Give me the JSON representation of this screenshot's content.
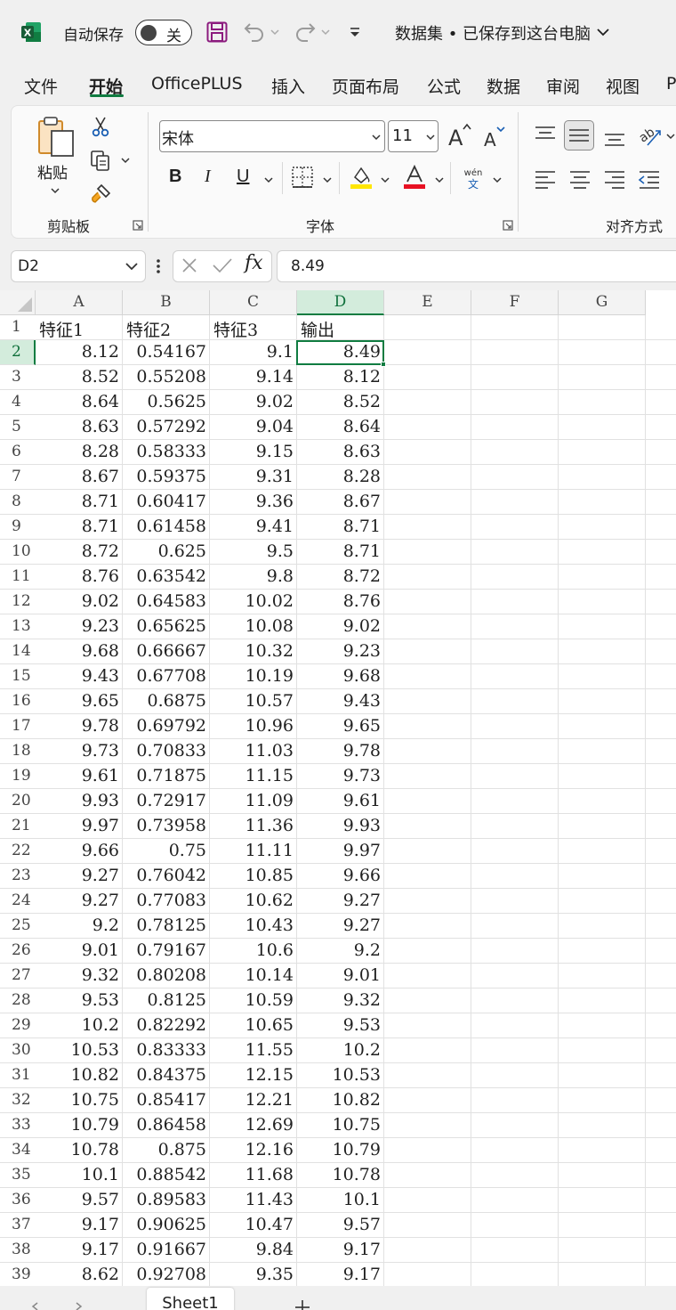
{
  "titlebar": {
    "autosave_label": "自动保存",
    "autosave_state": "关",
    "doc_title": "数据集 • 已保存到这台电脑",
    "logo_icon": "excel-logo-icon"
  },
  "tabs": [
    "文件",
    "开始",
    "OfficePLUS",
    "插入",
    "页面布局",
    "公式",
    "数据",
    "审阅",
    "视图",
    "P"
  ],
  "active_tab": "开始",
  "ribbon": {
    "clipboard_group": "剪贴板",
    "paste_label": "粘贴",
    "font_group": "字体",
    "align_group": "对齐方式",
    "font_name": "宋体",
    "font_size": "11",
    "bold": "B",
    "italic": "I",
    "underline": "U",
    "phonetic_top": "wén",
    "phonetic_bottom": "文",
    "grow_letter": "A",
    "shrink_letter": "A",
    "fill_color": "#ffe600",
    "font_color": "#e81123"
  },
  "formula_bar": {
    "name_box": "D2",
    "fx": "fx",
    "value": "8.49"
  },
  "grid": {
    "columns": [
      "A",
      "B",
      "C",
      "D",
      "E",
      "F",
      "G"
    ],
    "selected_column": "D",
    "selected_row": "2",
    "header_row": [
      "特征1",
      "特征2",
      "特征3",
      "输出"
    ],
    "row_numbers": [
      "1",
      "2",
      "3",
      "4",
      "5",
      "6",
      "7",
      "8",
      "9",
      "10",
      "11",
      "12",
      "13",
      "14",
      "15",
      "16",
      "17",
      "18",
      "19",
      "20",
      "21",
      "22",
      "23",
      "24",
      "25",
      "26",
      "27",
      "28",
      "29",
      "30",
      "31",
      "32",
      "33",
      "34",
      "35",
      "36",
      "37",
      "38",
      "39"
    ],
    "rows": [
      [
        "8.12",
        "0.54167",
        "9.1",
        "8.49"
      ],
      [
        "8.52",
        "0.55208",
        "9.14",
        "8.12"
      ],
      [
        "8.64",
        "0.5625",
        "9.02",
        "8.52"
      ],
      [
        "8.63",
        "0.57292",
        "9.04",
        "8.64"
      ],
      [
        "8.28",
        "0.58333",
        "9.15",
        "8.63"
      ],
      [
        "8.67",
        "0.59375",
        "9.31",
        "8.28"
      ],
      [
        "8.71",
        "0.60417",
        "9.36",
        "8.67"
      ],
      [
        "8.71",
        "0.61458",
        "9.41",
        "8.71"
      ],
      [
        "8.72",
        "0.625",
        "9.5",
        "8.71"
      ],
      [
        "8.76",
        "0.63542",
        "9.8",
        "8.72"
      ],
      [
        "9.02",
        "0.64583",
        "10.02",
        "8.76"
      ],
      [
        "9.23",
        "0.65625",
        "10.08",
        "9.02"
      ],
      [
        "9.68",
        "0.66667",
        "10.32",
        "9.23"
      ],
      [
        "9.43",
        "0.67708",
        "10.19",
        "9.68"
      ],
      [
        "9.65",
        "0.6875",
        "10.57",
        "9.43"
      ],
      [
        "9.78",
        "0.69792",
        "10.96",
        "9.65"
      ],
      [
        "9.73",
        "0.70833",
        "11.03",
        "9.78"
      ],
      [
        "9.61",
        "0.71875",
        "11.15",
        "9.73"
      ],
      [
        "9.93",
        "0.72917",
        "11.09",
        "9.61"
      ],
      [
        "9.97",
        "0.73958",
        "11.36",
        "9.93"
      ],
      [
        "9.66",
        "0.75",
        "11.11",
        "9.97"
      ],
      [
        "9.27",
        "0.76042",
        "10.85",
        "9.66"
      ],
      [
        "9.27",
        "0.77083",
        "10.62",
        "9.27"
      ],
      [
        "9.2",
        "0.78125",
        "10.43",
        "9.27"
      ],
      [
        "9.01",
        "0.79167",
        "10.6",
        "9.2"
      ],
      [
        "9.32",
        "0.80208",
        "10.14",
        "9.01"
      ],
      [
        "9.53",
        "0.8125",
        "10.59",
        "9.32"
      ],
      [
        "10.2",
        "0.82292",
        "10.65",
        "9.53"
      ],
      [
        "10.53",
        "0.83333",
        "11.55",
        "10.2"
      ],
      [
        "10.82",
        "0.84375",
        "12.15",
        "10.53"
      ],
      [
        "10.75",
        "0.85417",
        "12.21",
        "10.82"
      ],
      [
        "10.79",
        "0.86458",
        "12.69",
        "10.75"
      ],
      [
        "10.78",
        "0.875",
        "12.16",
        "10.79"
      ],
      [
        "10.1",
        "0.88542",
        "11.68",
        "10.78"
      ],
      [
        "9.57",
        "0.89583",
        "11.43",
        "10.1"
      ],
      [
        "9.17",
        "0.90625",
        "10.47",
        "9.57"
      ],
      [
        "9.17",
        "0.91667",
        "9.84",
        "9.17"
      ],
      [
        "8.62",
        "0.92708",
        "9.35",
        "9.17"
      ]
    ]
  },
  "sheets": {
    "active": "Sheet1",
    "add": "+"
  },
  "colors": {
    "accent": "#107c41",
    "chrome": "#f0f0f0"
  }
}
